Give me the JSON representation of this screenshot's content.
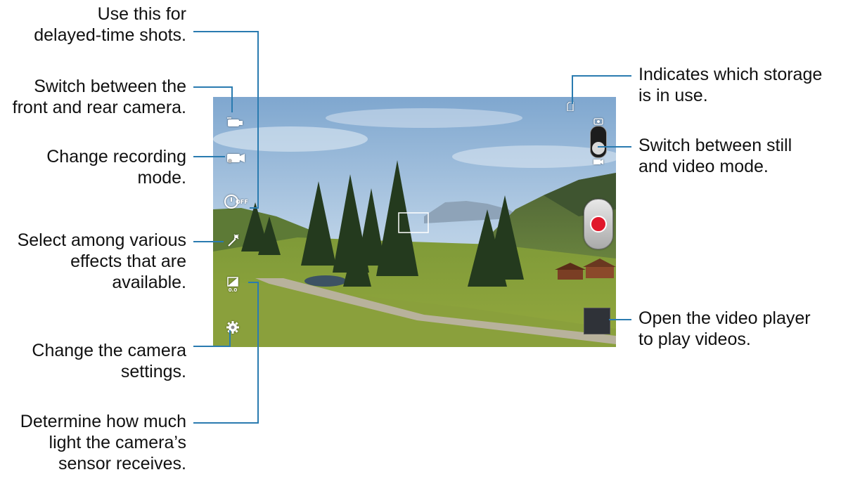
{
  "callouts": {
    "timer": [
      "Use this for",
      "delayed-time shots."
    ],
    "switch_camera": [
      "Switch between the",
      "front and rear camera."
    ],
    "recording_mode": [
      "Change recording",
      "mode."
    ],
    "effects": [
      "Select among various",
      "effects that are",
      "available."
    ],
    "settings": [
      "Change the camera",
      "settings."
    ],
    "exposure": [
      "Determine how much",
      "light the camera’s",
      "sensor receives."
    ],
    "storage": [
      "Indicates which storage",
      "is in use."
    ],
    "mode_switch": [
      "Switch between still",
      "and video mode."
    ],
    "video_player": [
      "Open the video player",
      "to play videos."
    ]
  },
  "hud": {
    "timer_label": "OFF",
    "exposure_value": "0.0"
  },
  "icons": {
    "switch_camera": "camera-flip-icon",
    "recording_mode": "video-mode-icon",
    "timer": "timer-off-icon",
    "effects": "magic-wand-icon",
    "exposure": "exposure-icon",
    "settings": "gear-icon",
    "storage": "sd-card-icon",
    "still": "camera-icon",
    "video": "video-icon",
    "record": "record-button"
  },
  "colors": {
    "leader": "#2a7bb0",
    "record": "#e0182b"
  }
}
